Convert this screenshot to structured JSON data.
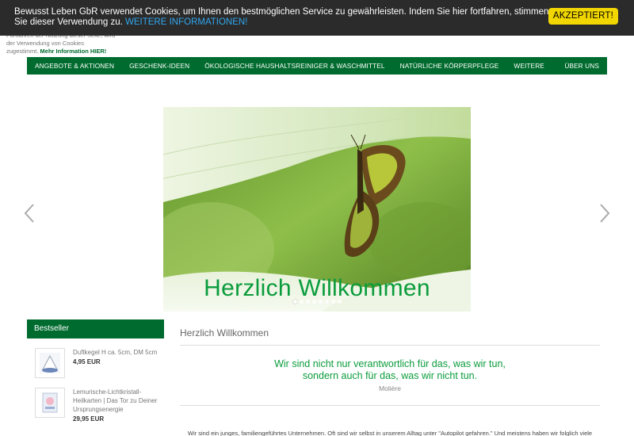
{
  "cookie": {
    "message": "Bewusst Leben GbR verwendet Cookies, um Ihnen den bestmöglichen Service zu gewährleisten. Indem Sie hier fortfahren, stimmen Sie dieser Verwendung zu.",
    "info_link": "WEITERE INFORMATIONEN!",
    "accept": "AKZEPTIERT!"
  },
  "under_notice": {
    "text": "Fortfahren der Nutzung dieser Seite, wird der Verwendung von Cookies zugestimmt.",
    "more_link": "Mehr Information HIER!"
  },
  "nav": {
    "items": [
      "ANGEBOTE & AKTIONEN",
      "GESCHENK-IDEEN",
      "ÖKOLOGISCHE HAUSHALTSREINIGER & WASCHMITTEL",
      "NATÜRLICHE KÖRPERPFLEGE",
      "WEITERE"
    ],
    "right": "ÜBER UNS"
  },
  "slider": {
    "caption": "Herzlich Willkommen",
    "dot_count": 8,
    "active_dot": 0
  },
  "sidebar": {
    "title": "Bestseller",
    "products": [
      {
        "name": "Duftkegel H ca. 5cm, DM 5cm",
        "price": "4,95 EUR",
        "icon": "cone-icon"
      },
      {
        "name": "Lemurische-Lichtkristall-Heilkarten | Das Tor zu Deiner Ursprungsenergie",
        "price": "29,95 EUR",
        "icon": "card-deck-icon"
      }
    ]
  },
  "main": {
    "title": "Herzlich Willkommen",
    "quote_line1": "Wir sind nicht nur verantwortlich für das, was wir tun,",
    "quote_line2": "sondern auch für das, was wir nicht tun.",
    "quote_author": "Molière",
    "paragraph": "Wir sind ein junges, familiengeführtes Unternehmen. Oft sind wir selbst in unserem Alltag unter \"Autopilot gefahren.\"  Und meistens haben wir folglich viele"
  },
  "colors": {
    "brand_green": "#006b2e",
    "quote_green": "#0a9c3c",
    "cookie_bg": "#2b2b2b",
    "accept_yellow": "#f1d600",
    "link_blue": "#31a8f0"
  }
}
